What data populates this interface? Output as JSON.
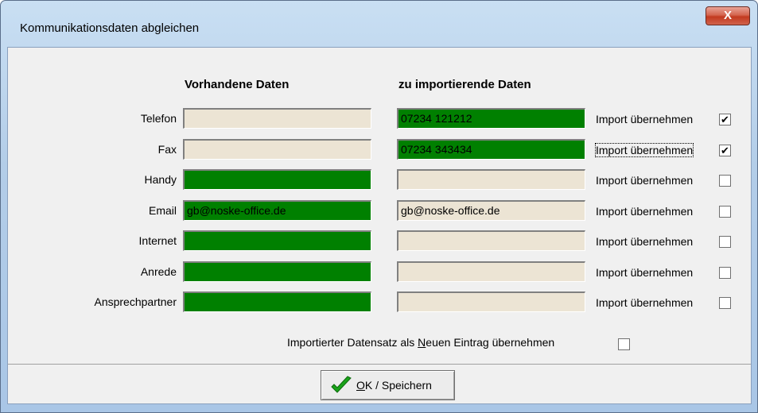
{
  "window": {
    "title": "Kommunikationsdaten abgleichen",
    "close_glyph": "X"
  },
  "headers": {
    "existing": "Vorhandene Daten",
    "import": "zu importierende Daten"
  },
  "rows": [
    {
      "label": "Telefon",
      "existing": "",
      "import": "07234 121212",
      "existing_green": false,
      "import_green": true,
      "checkbox_label": "Import übernehmen",
      "checked": true
    },
    {
      "label": "Fax",
      "existing": "",
      "import": "07234 343434",
      "existing_green": false,
      "import_green": true,
      "checkbox_label": "Import übernehmen",
      "checked": true
    },
    {
      "label": "Handy",
      "existing": "",
      "import": "",
      "existing_green": true,
      "import_green": false,
      "checkbox_label": "Import übernehmen",
      "checked": false
    },
    {
      "label": "Email",
      "existing": "gb@noske-office.de",
      "import": "gb@noske-office.de",
      "existing_green": true,
      "import_green": false,
      "checkbox_label": "Import übernehmen",
      "checked": false
    },
    {
      "label": "Internet",
      "existing": "",
      "import": "",
      "existing_green": true,
      "import_green": false,
      "checkbox_label": "Import übernehmen",
      "checked": false
    },
    {
      "label": "Anrede",
      "existing": "",
      "import": "",
      "existing_green": true,
      "import_green": false,
      "checkbox_label": "Import übernehmen",
      "checked": false
    },
    {
      "label": "Ansprechpartner",
      "existing": "",
      "import": "",
      "existing_green": true,
      "import_green": false,
      "checkbox_label": "Import übernehmen",
      "checked": false
    }
  ],
  "new_entry": {
    "label_before": "Importierter Datensatz als ",
    "label_mnemonic": "N",
    "label_after": "euen Eintrag übernehmen",
    "checked": false
  },
  "ok_button": {
    "mnemonic": "O",
    "label_rest": "K / Speichern",
    "icon": "checkmark-icon"
  },
  "colors": {
    "green": "#008000",
    "field_beige": "#ece4d4",
    "check_green": "#1aa31a"
  }
}
